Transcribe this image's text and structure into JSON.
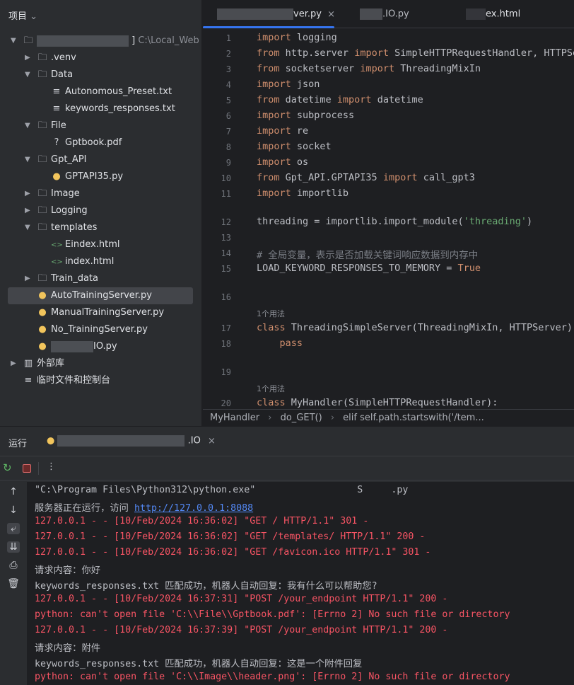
{
  "sidebar": {
    "title": "项目",
    "root_path": "C:\\Local_Web",
    "items": [
      {
        "label": ".venv",
        "type": "folder",
        "level": 1,
        "expanded": false
      },
      {
        "label": "Data",
        "type": "folder",
        "level": 1,
        "expanded": true
      },
      {
        "label": "Autonomous_Preset.txt",
        "type": "txt",
        "level": 2
      },
      {
        "label": "keywords_responses.txt",
        "type": "txt",
        "level": 2
      },
      {
        "label": "File",
        "type": "folder",
        "level": 1,
        "expanded": true
      },
      {
        "label": "Gptbook.pdf",
        "type": "unknown",
        "level": 2
      },
      {
        "label": "Gpt_API",
        "type": "folder",
        "level": 1,
        "expanded": true
      },
      {
        "label": "GPTAPI35.py",
        "type": "py",
        "level": 2
      },
      {
        "label": "Image",
        "type": "folder",
        "level": 1,
        "expanded": false
      },
      {
        "label": "Logging",
        "type": "folder",
        "level": 1,
        "expanded": false
      },
      {
        "label": "templates",
        "type": "folder",
        "level": 1,
        "expanded": true
      },
      {
        "label": "Eindex.html",
        "type": "html",
        "level": 2
      },
      {
        "label": "index.html",
        "type": "html",
        "level": 2
      },
      {
        "label": "Train_data",
        "type": "folder",
        "level": 1,
        "expanded": false
      },
      {
        "label": "AutoTrainingServer.py",
        "type": "py",
        "level": 1,
        "selected": true
      },
      {
        "label": "ManualTrainingServer.py",
        "type": "py",
        "level": 1
      },
      {
        "label": "No_TrainingServer.py",
        "type": "py",
        "level": 1
      },
      {
        "label": "IO.py",
        "type": "py",
        "level": 1,
        "redacted": true
      }
    ],
    "external_libs": "外部库",
    "scratches": "临时文件和控制台"
  },
  "editor": {
    "tabs": [
      {
        "label": "ver.py",
        "active": true
      },
      {
        "label": ".IO.py"
      },
      {
        "label": "ex.html"
      }
    ],
    "lines": [
      {
        "n": "1",
        "code": "import logging"
      },
      {
        "n": "2",
        "code": "from http.server import SimpleHTTPRequestHandler, HTTPSe"
      },
      {
        "n": "3",
        "code": "from socketserver import ThreadingMixIn"
      },
      {
        "n": "4",
        "code": "import json"
      },
      {
        "n": "5",
        "code": "from datetime import datetime"
      },
      {
        "n": "6",
        "code": "import subprocess"
      },
      {
        "n": "7",
        "code": "import re"
      },
      {
        "n": "8",
        "code": "import socket"
      },
      {
        "n": "9",
        "code": "import os"
      },
      {
        "n": "10",
        "code": "from Gpt_API.GPTAPI35 import call_gpt3"
      },
      {
        "n": "11",
        "code": "import importlib"
      },
      {
        "n": "12",
        "code": "threading = importlib.import_module('threading')"
      },
      {
        "n": "13",
        "code": ""
      },
      {
        "n": "14",
        "code": "# 全局变量，表示是否加载关键词响应数据到内存中"
      },
      {
        "n": "15",
        "code": "LOAD_KEYWORD_RESPONSES_TO_MEMORY = True"
      },
      {
        "n": "16",
        "code": ""
      },
      {
        "n": "17",
        "code": "class ThreadingSimpleServer(ThreadingMixIn, HTTPServer):",
        "usage": "1个用法"
      },
      {
        "n": "18",
        "code": "    pass"
      },
      {
        "n": "19",
        "code": ""
      },
      {
        "n": "20",
        "code": "class MyHandler(SimpleHTTPRequestHandler):",
        "usage": "1个用法"
      }
    ],
    "breadcrumb": [
      "MyHandler",
      "do_GET()",
      "elif self.path.startswith('/tem..."
    ]
  },
  "run": {
    "title": "运行",
    "tab_label": ".IO",
    "output": [
      {
        "text": "\"C:\\Program Files\\Python312\\python.exe\"                  S     .py",
        "kind": "normal"
      },
      {
        "text": "服务器正在运行，访问 ",
        "link": "http://127.0.0.1:8088",
        "kind": "normal"
      },
      {
        "text": "127.0.0.1 - - [10/Feb/2024 16:36:02] \"GET / HTTP/1.1\" 301 -",
        "kind": "err"
      },
      {
        "text": "127.0.0.1 - - [10/Feb/2024 16:36:02] \"GET /templates/ HTTP/1.1\" 200 -",
        "kind": "err"
      },
      {
        "text": "127.0.0.1 - - [10/Feb/2024 16:36:02] \"GET /favicon.ico HTTP/1.1\" 301 -",
        "kind": "err"
      },
      {
        "text": "请求内容：你好",
        "kind": "normal"
      },
      {
        "text": "keywords_responses.txt 匹配成功，机器人自动回复：我有什么可以帮助您?",
        "kind": "normal"
      },
      {
        "text": "127.0.0.1 - - [10/Feb/2024 16:37:31] \"POST /your_endpoint HTTP/1.1\" 200 -",
        "kind": "err"
      },
      {
        "text": "python: can't open file 'C:\\\\File\\\\Gptbook.pdf': [Errno 2] No such file or directory",
        "kind": "err"
      },
      {
        "text": "127.0.0.1 - - [10/Feb/2024 16:37:39] \"POST /your_endpoint HTTP/1.1\" 200 -",
        "kind": "err"
      },
      {
        "text": "请求内容：附件",
        "kind": "normal"
      },
      {
        "text": "keywords_responses.txt 匹配成功，机器人自动回复：这是一个附件回复",
        "kind": "normal"
      },
      {
        "text": "python: can't open file 'C:\\\\Image\\\\header.png': [Errno 2] No such file or directory",
        "kind": "err"
      }
    ]
  },
  "colors": {
    "accent": "#3574f0",
    "keyword": "#cf8e6d",
    "string": "#6aab73",
    "error": "#f75464",
    "link": "#548af7"
  }
}
